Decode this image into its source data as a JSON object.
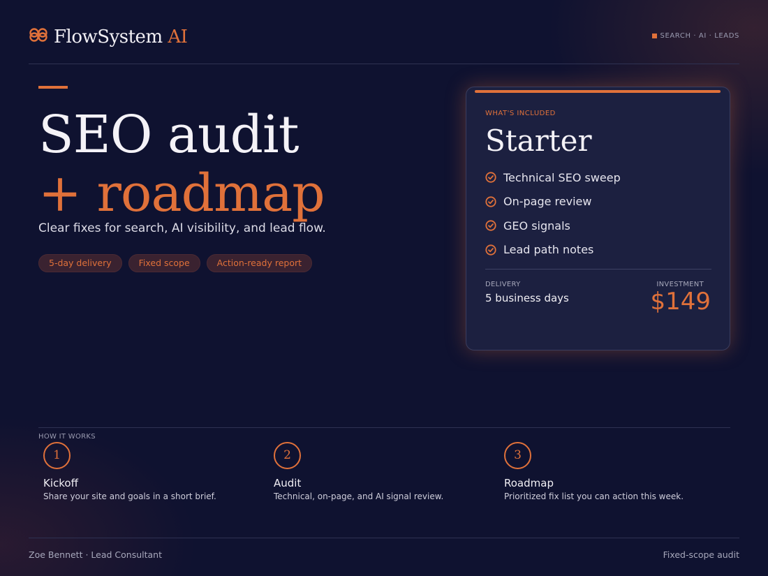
{
  "brand": {
    "name": "FlowSystem",
    "name_accent": "AI",
    "tagline": "SEARCH · AI · LEADS"
  },
  "hero": {
    "line1": "SEO audit",
    "line2": "+ roadmap",
    "subtitle": "Clear fixes for search, AI visibility, and lead flow.",
    "chips": [
      "5-day delivery",
      "Fixed scope",
      "Action-ready report"
    ]
  },
  "card": {
    "eyebrow": "WHAT'S INCLUDED",
    "plan": "Starter",
    "features": [
      "Technical SEO sweep",
      "On-page review",
      "GEO signals",
      "Lead path notes"
    ],
    "delivery_label": "DELIVERY",
    "delivery_value": "5 business days",
    "investment_label": "INVESTMENT",
    "price": "$149"
  },
  "how": {
    "label": "HOW IT WORKS",
    "steps": [
      {
        "num": "1",
        "title": "Kickoff",
        "desc": "Share your site and goals in a short brief."
      },
      {
        "num": "2",
        "title": "Audit",
        "desc": "Technical, on-page, and AI signal review."
      },
      {
        "num": "3",
        "title": "Roadmap",
        "desc": "Prioritized fix list you can action this week."
      }
    ]
  },
  "footer": {
    "left": "Zoe Bennett · Lead Consultant",
    "right": "Fixed-scope audit"
  },
  "colors": {
    "accent": "#e0713a",
    "background": "#0f1230",
    "card": "#1c2040"
  },
  "icons": {
    "logo": "infinity-logo-icon",
    "feature": "check-circle-icon"
  }
}
